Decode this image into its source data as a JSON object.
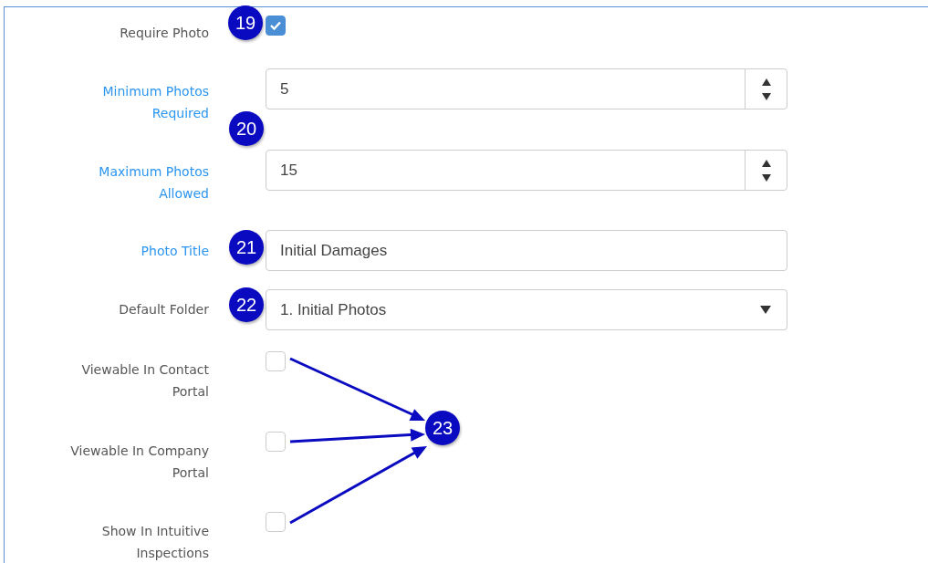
{
  "fields": [
    {
      "kind": "checkbox",
      "label": "Require Photo",
      "highlighted": false,
      "checked": true,
      "badge": "19",
      "arrow": false
    },
    {
      "kind": "number",
      "label": "Minimum Photos Required",
      "highlighted": true,
      "value": "5",
      "badge": "20",
      "arrow": false
    },
    {
      "kind": "number",
      "label": "Maximum Photos Allowed",
      "highlighted": true,
      "value": "15",
      "arrow": false
    },
    {
      "kind": "text",
      "label": "Photo Title",
      "highlighted": true,
      "value": "Initial Damages",
      "badge": "21",
      "arrow": false
    },
    {
      "kind": "select",
      "label": "Default Folder",
      "highlighted": false,
      "value": "1. Initial Photos",
      "badge": "22",
      "arrow": false
    },
    {
      "kind": "checkbox",
      "label": "Viewable In Contact Portal",
      "highlighted": false,
      "checked": false,
      "arrow": true
    },
    {
      "kind": "checkbox",
      "label": "Viewable In Company Portal",
      "highlighted": false,
      "checked": false,
      "arrow": true
    },
    {
      "kind": "checkbox",
      "label": "Show In Intuitive Inspections",
      "highlighted": false,
      "checked": false,
      "arrow": true
    }
  ],
  "callout": {
    "number": "23"
  }
}
